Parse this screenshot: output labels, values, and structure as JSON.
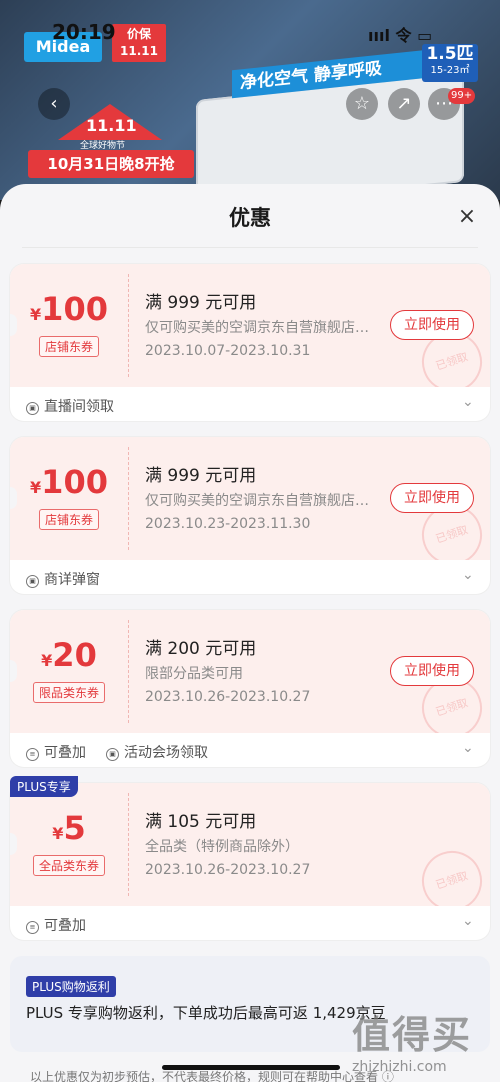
{
  "status_bar": {
    "time": "20:19",
    "signal": "ıııl 令 ▭"
  },
  "banner": {
    "brand_logo": "Midea",
    "price_protect": "价保\n11.11",
    "spec_main": "1.5匹",
    "spec_sub": "15-23㎡",
    "slogan": "净化空气 静享呼吸",
    "promo_title": "11.11",
    "promo_sub": "全球好物节",
    "promo_date": "10月31日晚8开抢",
    "back_icon": "‹",
    "star_icon": "☆",
    "share_icon": "↗",
    "more_icon": "⋯",
    "badge": "99+"
  },
  "sheet": {
    "title": "优惠",
    "close_icon": "×",
    "coupons": [
      {
        "symbol": "¥",
        "amount": "100",
        "tag": "店铺东券",
        "condition": "满 999 元可用",
        "desc": "仅可购买美的空调京东自营旗舰店部分商品",
        "dates": "2023.10.07-2023.10.31",
        "button": "立即使用",
        "stamp": "已领取",
        "footer": [
          {
            "icon": "▣",
            "text": "直播间领取"
          }
        ]
      },
      {
        "symbol": "¥",
        "amount": "100",
        "tag": "店铺东券",
        "condition": "满 999 元可用",
        "desc": "仅可购买美的空调京东自营旗舰店部分商品",
        "dates": "2023.10.23-2023.11.30",
        "button": "立即使用",
        "stamp": "已领取",
        "footer": [
          {
            "icon": "▣",
            "text": "商详弹窗"
          }
        ]
      },
      {
        "symbol": "¥",
        "amount": "20",
        "tag": "限品类东券",
        "condition": "满 200 元可用",
        "desc": "限部分品类可用",
        "dates": "2023.10.26-2023.10.27",
        "button": "立即使用",
        "stamp": "已领取",
        "footer": [
          {
            "icon": "≡",
            "text": "可叠加"
          },
          {
            "icon": "▣",
            "text": "活动会场领取"
          }
        ]
      },
      {
        "plus": "PLUS专享",
        "symbol": "¥",
        "amount": "5",
        "tag": "全品类东券",
        "condition": "满 105 元可用",
        "desc": "全品类（特例商品除外）",
        "dates": "2023.10.26-2023.10.27",
        "stamp": "已领取",
        "footer": [
          {
            "icon": "≡",
            "text": "可叠加"
          }
        ]
      }
    ],
    "plus_card": {
      "tag": "PLUS购物返利",
      "text": "PLUS 专享购物返利，下单成功后最高可返 1,429京豆"
    },
    "disclaimer": "以上优惠仅为初步预估，不代表最终价格，规则可在帮助中心查看 ⓘ"
  },
  "watermark": {
    "main": "值得买",
    "sub": "zhizhizhi.com"
  }
}
